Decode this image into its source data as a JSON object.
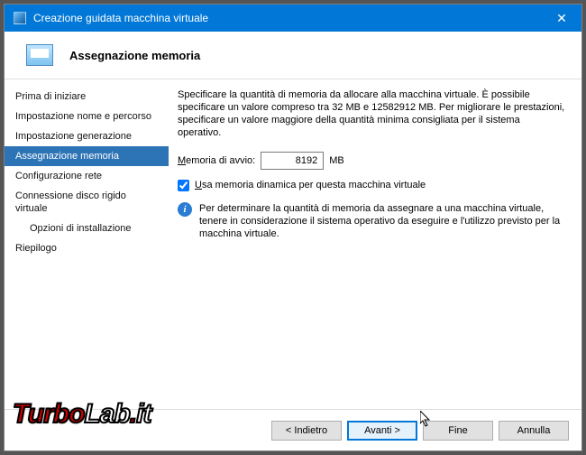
{
  "titlebar": {
    "title": "Creazione guidata macchina virtuale",
    "close_glyph": "✕"
  },
  "header": {
    "title": "Assegnazione memoria"
  },
  "sidebar": {
    "items": [
      {
        "label": "Prima di iniziare"
      },
      {
        "label": "Impostazione nome e percorso"
      },
      {
        "label": "Impostazione generazione"
      },
      {
        "label": "Assegnazione memoria"
      },
      {
        "label": "Configurazione rete"
      },
      {
        "label": "Connessione disco rigido virtuale"
      },
      {
        "label": "Opzioni di installazione"
      },
      {
        "label": "Riepilogo"
      }
    ],
    "selected_index": 3
  },
  "content": {
    "description": "Specificare la quantità di memoria da allocare alla macchina virtuale. È possibile specificare un valore compreso tra 32 MB e 12582912 MB. Per migliorare le prestazioni, specificare un valore maggiore della quantità minima consigliata per il sistema operativo.",
    "memory_label_prefix_ul": "M",
    "memory_label_rest": "emoria di avvio:",
    "memory_value": "8192",
    "memory_unit": "MB",
    "dynamic_checkbox_prefix_ul": "U",
    "dynamic_checkbox_rest": "sa memoria dinamica per questa macchina virtuale",
    "dynamic_checked": true,
    "info_text": "Per determinare la quantità di memoria da assegnare a una macchina virtuale, tenere in considerazione il sistema operativo da eseguire e l'utilizzo previsto per la macchina virtuale.",
    "info_glyph": "i"
  },
  "footer": {
    "back": "< Indietro",
    "next": "Avanti >",
    "finish": "Fine",
    "cancel": "Annulla"
  },
  "watermark": {
    "turbo": "Turbo",
    "lab": "Lab",
    "dot": ".",
    "it": "it"
  }
}
